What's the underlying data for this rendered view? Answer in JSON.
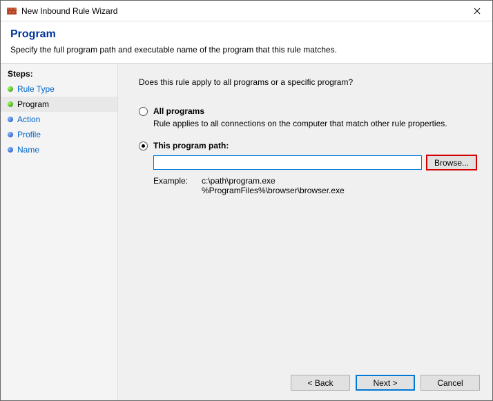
{
  "window": {
    "title": "New Inbound Rule Wizard"
  },
  "header": {
    "title": "Program",
    "subtitle": "Specify the full program path and executable name of the program that this rule matches."
  },
  "sidebar": {
    "heading": "Steps:",
    "items": [
      {
        "label": "Rule Type",
        "state": "completed"
      },
      {
        "label": "Program",
        "state": "current"
      },
      {
        "label": "Action",
        "state": "pending"
      },
      {
        "label": "Profile",
        "state": "pending"
      },
      {
        "label": "Name",
        "state": "pending"
      }
    ]
  },
  "main": {
    "question": "Does this rule apply to all programs or a specific program?",
    "options": {
      "all": {
        "label": "All programs",
        "desc": "Rule applies to all connections on the computer that match other rule properties.",
        "selected": false
      },
      "path": {
        "label": "This program path:",
        "selected": true,
        "input_value": "",
        "browse_label": "Browse...",
        "example_label": "Example:",
        "example_line1": "c:\\path\\program.exe",
        "example_line2": "%ProgramFiles%\\browser\\browser.exe"
      }
    }
  },
  "footer": {
    "back": "< Back",
    "next": "Next >",
    "cancel": "Cancel"
  }
}
